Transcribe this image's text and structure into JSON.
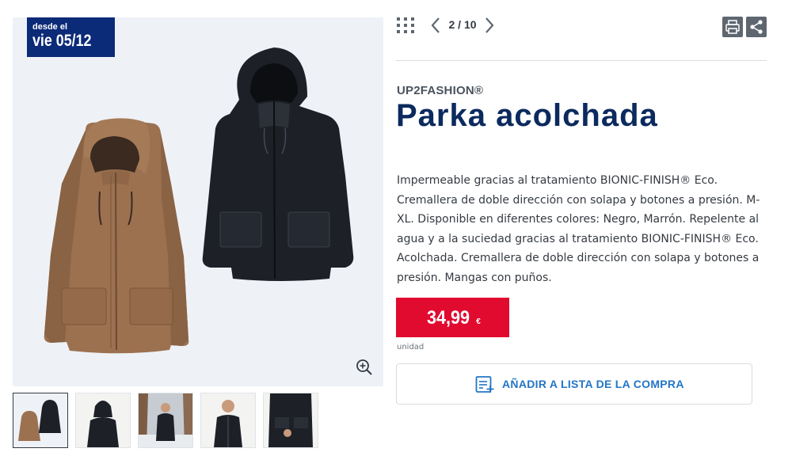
{
  "badge": {
    "line1": "desde el",
    "line2": "vie 05/12"
  },
  "pager": {
    "text": "2 / 10"
  },
  "product": {
    "brand": "UP2FASHION®",
    "title": "Parka acolchada",
    "description": "Impermeable gracias al tratamiento BIONIC-FINISH® Eco. Cremallera de doble dirección con solapa y botones a presión. M-XL. Disponible en diferentes colores: Negro, Marrón. Repelente al agua y a la suciedad gracias al tratamiento BIONIC-FINISH® Eco. Acolchada. Cremallera de doble dirección con solapa y botones a presión. Mangas con puños."
  },
  "price": {
    "value": "34,99",
    "currency": "€",
    "unit": "unidad"
  },
  "actions": {
    "add_to_list": "AÑADIR A LISTA DE LA COMPRA"
  },
  "icons": {
    "grid": "grid-icon",
    "prev": "chevron-left-icon",
    "next": "chevron-right-icon",
    "print": "print-icon",
    "share": "share-icon",
    "zoom": "zoom-in-icon",
    "list": "shopping-list-add-icon"
  },
  "colors": {
    "brand_navy": "#0b2a78",
    "title_navy": "#0b2a5e",
    "price_red": "#e10b2f",
    "link_blue": "#2375c6"
  },
  "thumbnails": [
    "both-parkas",
    "model-hood-front",
    "model-snow-outdoor",
    "model-front-zip",
    "model-detail-pocket"
  ]
}
